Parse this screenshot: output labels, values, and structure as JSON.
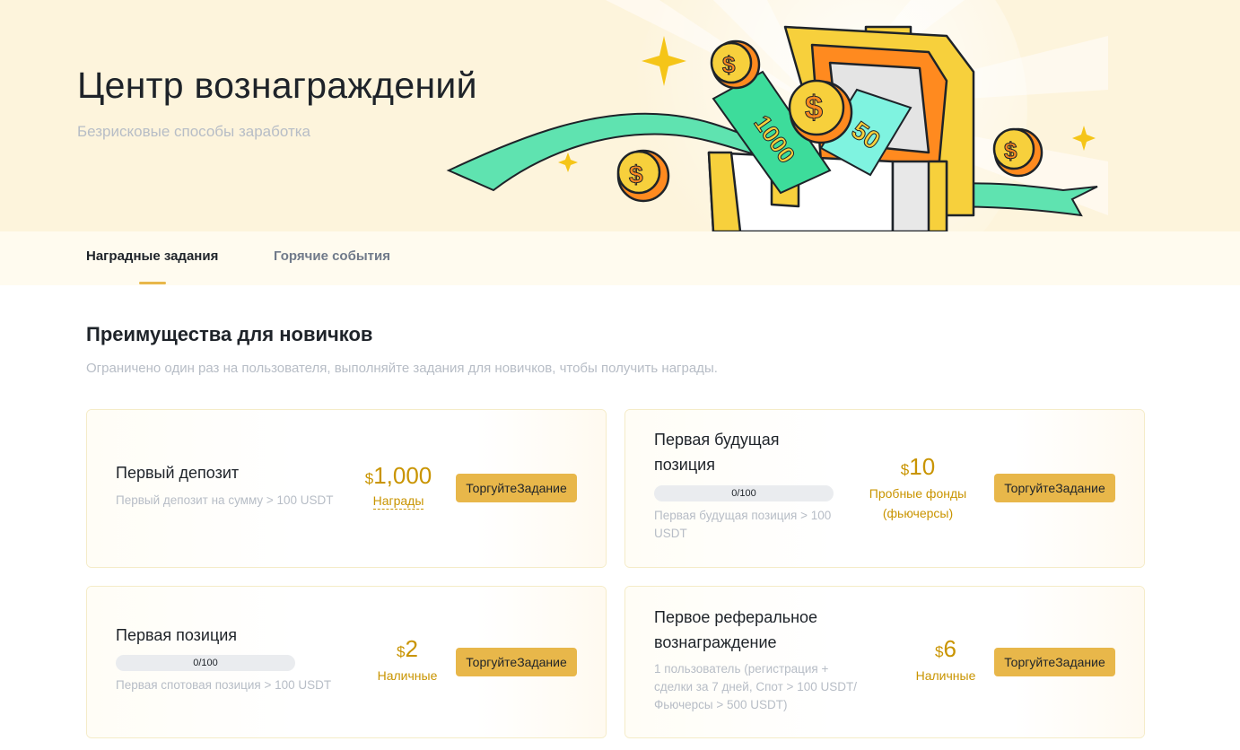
{
  "hero": {
    "title": "Центр вознаграждений",
    "subtitle": "Безрисковые способы заработка",
    "art_voucher_1": "1000",
    "art_voucher_2": "50"
  },
  "tabs": [
    {
      "label": "Наградные задания",
      "active": true
    },
    {
      "label": "Горячие события",
      "active": false
    }
  ],
  "section": {
    "title": "Преимущества для новичков",
    "subtitle": "Ограничено один раз на пользователя, выполняйте задания для новичков, чтобы получить награды."
  },
  "cards": [
    {
      "title": "Первый депозит",
      "description": "Первый депозит на сумму > 100 USDT",
      "currency": "$",
      "amount": "1,000",
      "reward_label": "Награды",
      "button": "ТоргуйтеЗадание"
    },
    {
      "title": "Первая будущая позиция",
      "progress": "0/100",
      "progress_fraction": 0,
      "description": "Первая будущая позиция > 100 USDT",
      "currency": "$",
      "amount": "10",
      "reward_label": "Пробные фонды (фьючерсы)",
      "button": "ТоргуйтеЗадание"
    },
    {
      "title": "Первая позиция",
      "progress": "0/100",
      "progress_fraction": 0,
      "description": "Первая спотовая позиция > 100 USDT",
      "currency": "$",
      "amount": "2",
      "reward_label": "Наличные",
      "button": "ТоргуйтеЗадание"
    },
    {
      "title": "Первое реферальное вознаграждение",
      "description": "1 пользователь (регистрация + сделки за 7 дней, Спот > 100 USDT/ Фьючерсы > 500 USDT)",
      "currency": "$",
      "amount": "6",
      "reward_label": "Наличные",
      "button": "ТоргуйтеЗадание"
    }
  ],
  "colors": {
    "accent": "#e8b74a",
    "reward_text": "#c99400",
    "hero_bg": "#fdf4dc"
  }
}
